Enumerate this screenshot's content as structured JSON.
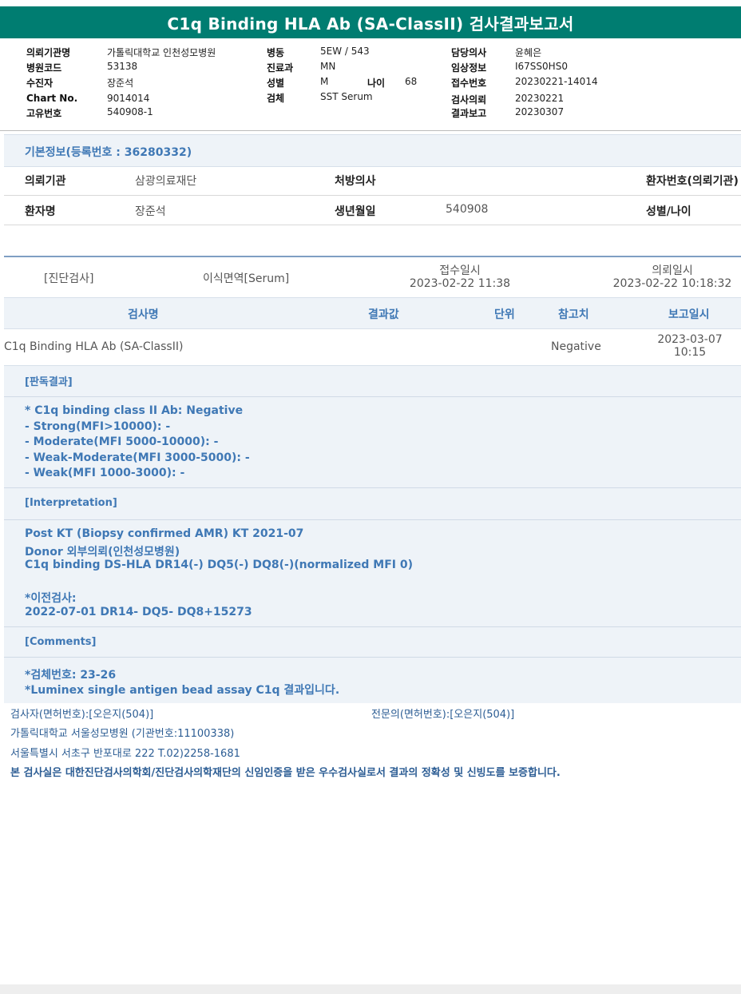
{
  "title": "C1q Binding HLA Ab (SA-ClassII) 검사결과보고서",
  "header": {
    "col1": [
      {
        "label": "의뢰기관명",
        "value": "가톨릭대학교 인천성모병원"
      },
      {
        "label": "병원코드",
        "value": "53138"
      },
      {
        "label": "수진자",
        "value": "장준석"
      },
      {
        "label": "Chart No.",
        "value": "9014014"
      },
      {
        "label": "고유번호",
        "value": "540908-1"
      }
    ],
    "col2": [
      {
        "label": "병동",
        "value": "5EW / 543"
      },
      {
        "label": "진료과",
        "value": "MN"
      },
      {
        "label": "성별",
        "value": "M"
      },
      {
        "label": "검체",
        "value": "SST Serum"
      }
    ],
    "age_label": "나이",
    "age_value": "68",
    "col3": [
      {
        "label": "담당의사",
        "value": "윤혜은"
      },
      {
        "label": "임상정보",
        "value": "I67SS0HS0"
      },
      {
        "label": "접수번호",
        "value": "20230221-14014"
      },
      {
        "label": "검사의뢰",
        "value": "20230221"
      },
      {
        "label": "결과보고",
        "value": "20230307"
      }
    ]
  },
  "basic_info": {
    "title": "기본정보(등록번호 : 36280332)",
    "institution_label": "의뢰기관",
    "institution_value": "삼광의료재단",
    "doctor_label": "처방의사",
    "patient_no_label": "환자번호(의뢰기관)",
    "name_label": "환자명",
    "name_value": "장준석",
    "birth_label": "생년월일",
    "birth_value": "540908",
    "sexage_label": "성별/나이"
  },
  "exam_meta": {
    "category": "[진단검사]",
    "department": "이식면역[Serum]",
    "received_label": "접수일시",
    "received_value": "2023-02-22 11:38",
    "requested_label": "의뢰일시",
    "requested_value": "2023-02-22 10:18:32"
  },
  "table": {
    "headers": {
      "name": "검사명",
      "result": "결과값",
      "unit": "단위",
      "reference": "참고치",
      "report_date": "보고일시"
    },
    "row": {
      "name": "C1q Binding HLA Ab (SA-ClassII)",
      "reference": "Negative",
      "report_date_1": "2023-03-07",
      "report_date_2": "10:15"
    }
  },
  "findings": {
    "judgment_title": "[판독결과]",
    "judgment_lines": [
      "* C1q binding class II Ab: Negative",
      "- Strong(MFI>10000): -",
      "- Moderate(MFI 5000-10000): -",
      "- Weak-Moderate(MFI 3000-5000): -",
      "- Weak(MFI 1000-3000): -"
    ],
    "interpretation_title": "[Interpretation]",
    "interpretation_lines": [
      "Post KT (Biopsy confirmed AMR) KT 2021-07",
      "Donor 외부의뢰(인천성모병원)",
      "C1q binding DS-HLA DR14(-) DQ5(-) DQ8(-)(normalized MFI 0)"
    ],
    "previous_lines": [
      "*이전검사:",
      "2022-07-01 DR14- DQ5- DQ8+15273"
    ],
    "comments_title": "[Comments]",
    "comments_lines": [
      "*검체번호: 23-26",
      "*Luminex single antigen bead assay C1q 결과입니다."
    ]
  },
  "footer": {
    "tester": "검사자(면허번호):[오은지(504)]",
    "specialist": "전문의(면허번호):[오은지(504)]",
    "lab_name": "가톨릭대학교 서울성모병원 (기관번호:11100338)",
    "address": "서울특별시 서초구 반포대로 222 T.02)2258-1681",
    "certification": "본 검사실은 대한진단검사의학회/진단검사의학재단의 신임인증을 받은 우수검사실로서 결과의 정확성 및 신빙도를 보증합니다."
  }
}
